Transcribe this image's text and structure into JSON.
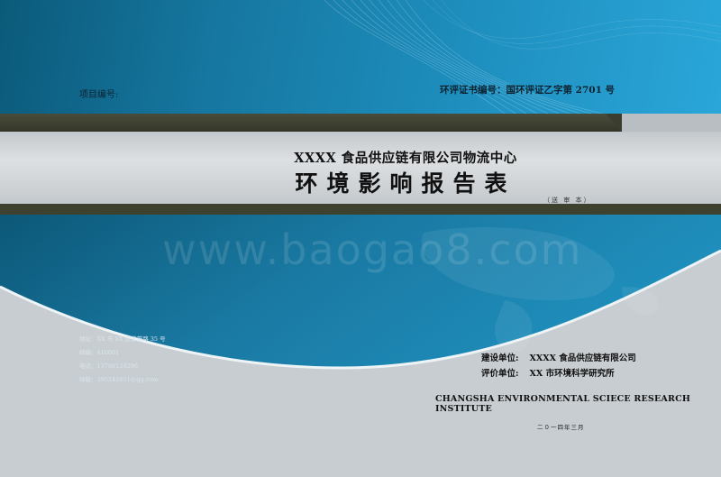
{
  "header": {
    "project_no_label": "项目编号:",
    "certificate_no": "环评证书编号：国环评证乙字第 2701 号"
  },
  "title": {
    "company_line": "XXXX 食品供应链有限公司物流中心",
    "report_type": "环境影响报告表",
    "edition": "（送 审 本）"
  },
  "watermark": "www.baogao8.com",
  "contact": {
    "address": "地址：XX 市 XX 区紫薇路 35 号",
    "postcode": "邮编：410001",
    "phone": "电话：13786124296",
    "email": "邮箱：395242651@qq.com"
  },
  "organizations": {
    "builder_label": "建设单位:",
    "builder_value": "XXXX 食品供应链有限公司",
    "assessor_label": "评价单位:",
    "assessor_value": "XX 市环境科学研究所"
  },
  "institute_en": "CHANGSHA ENVIRONMENTAL SCIECE RESEARCH INSTITUTE",
  "date": "二０一四年三月",
  "colors": {
    "band_dark": "#0b5a7a",
    "band_light": "#2aa6d8",
    "bar": "#3b3d2f",
    "panel": "#c8cdd1"
  }
}
